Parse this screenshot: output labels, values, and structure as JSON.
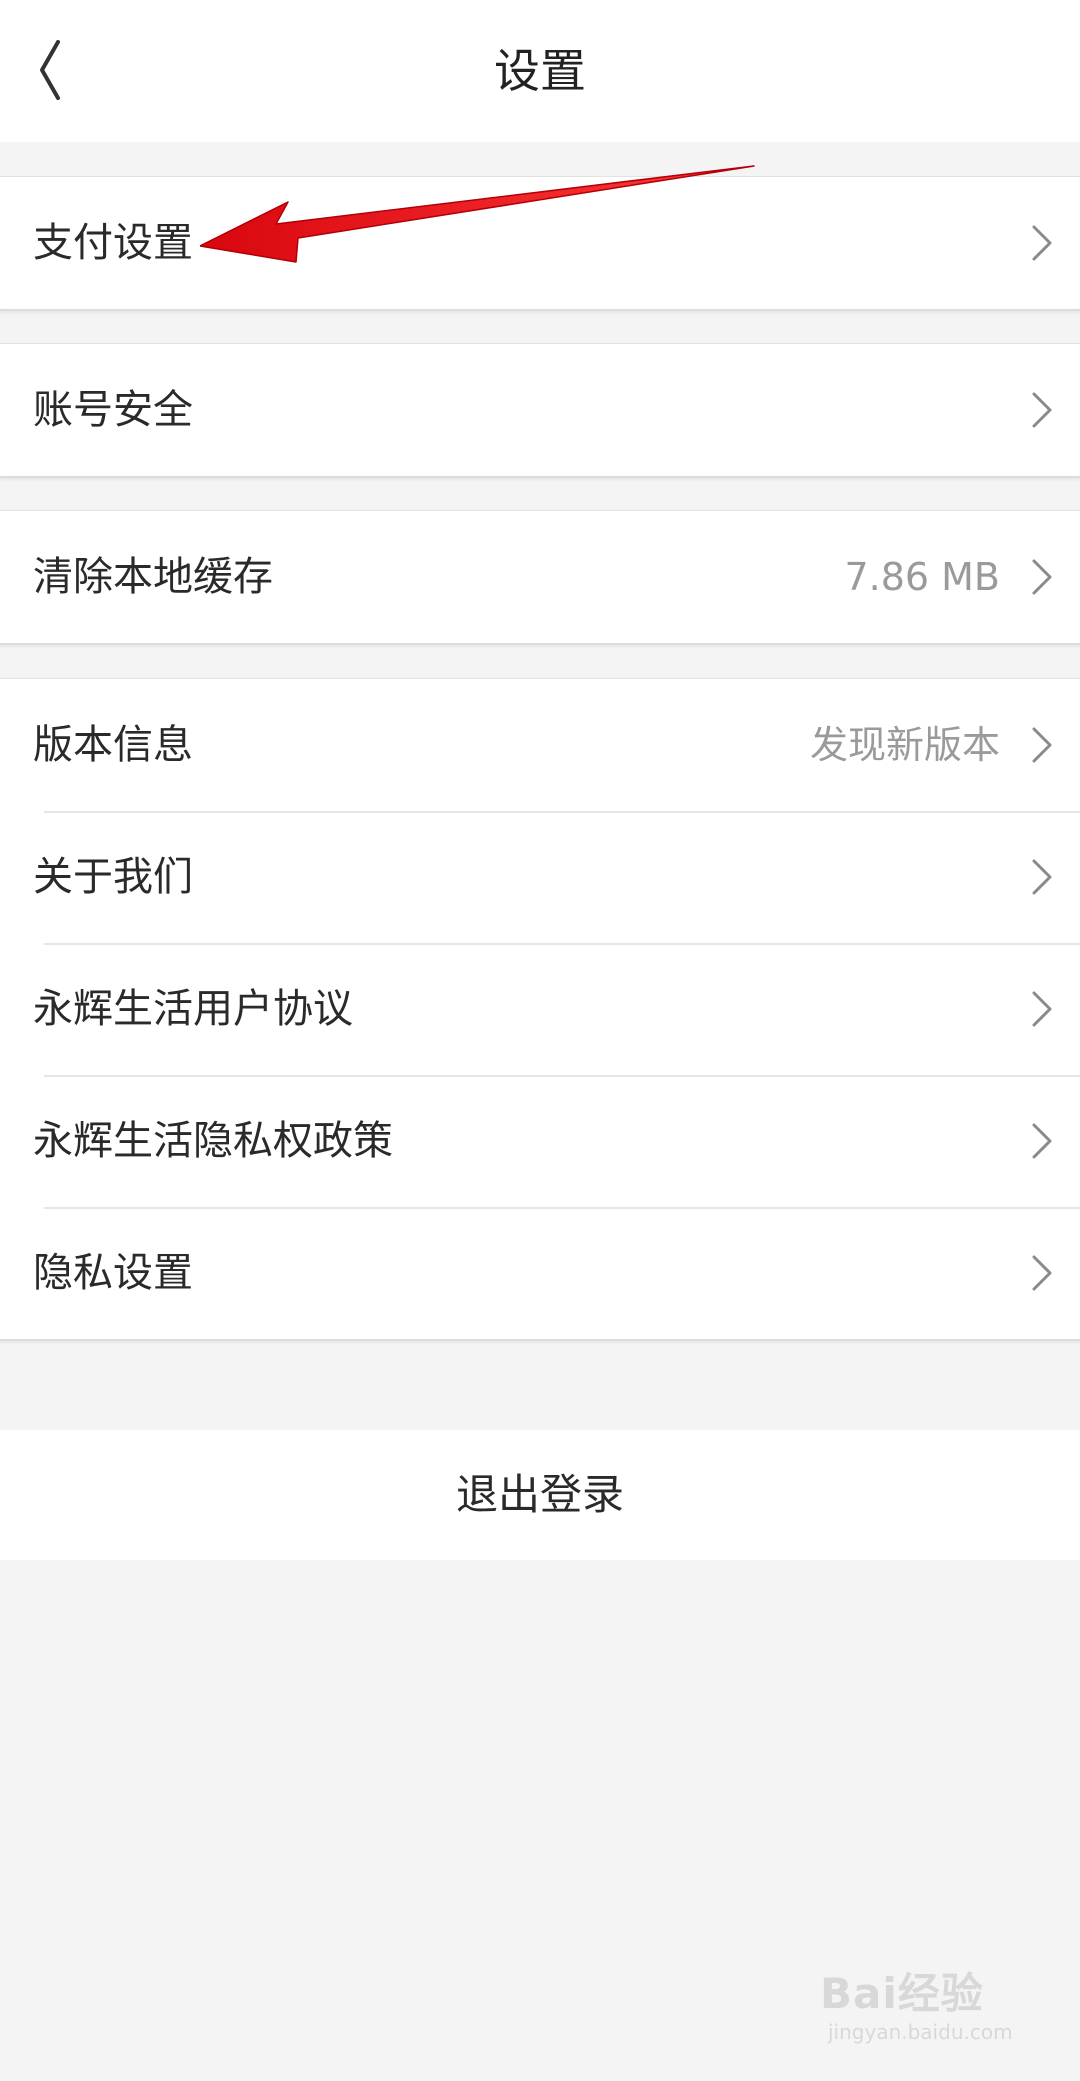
{
  "header": {
    "title": "设置",
    "back_icon": "chevron-left-icon"
  },
  "sections": [
    {
      "items": [
        {
          "label": "支付设置",
          "value": ""
        }
      ]
    },
    {
      "items": [
        {
          "label": "账号安全",
          "value": ""
        }
      ]
    },
    {
      "items": [
        {
          "label": "清除本地缓存",
          "value": "7.86 MB"
        }
      ]
    },
    {
      "items": [
        {
          "label": "版本信息",
          "value": "发现新版本"
        },
        {
          "label": "关于我们",
          "value": ""
        },
        {
          "label": "永辉生活用户协议",
          "value": ""
        },
        {
          "label": "永辉生活隐私权政策",
          "value": ""
        },
        {
          "label": "隐私设置",
          "value": ""
        }
      ]
    }
  ],
  "logout": {
    "label": "退出登录"
  },
  "annotation": {
    "type": "red-arrow",
    "color": "#e8141c"
  },
  "watermark": {
    "brand": "Bai经验",
    "url": "jingyan.baidu.com"
  },
  "colors": {
    "background": "#f4f4f4",
    "card": "#ffffff",
    "text": "#2a2a2a",
    "secondary_text": "#9a9a9a",
    "accent_annotation": "#e8141c"
  }
}
